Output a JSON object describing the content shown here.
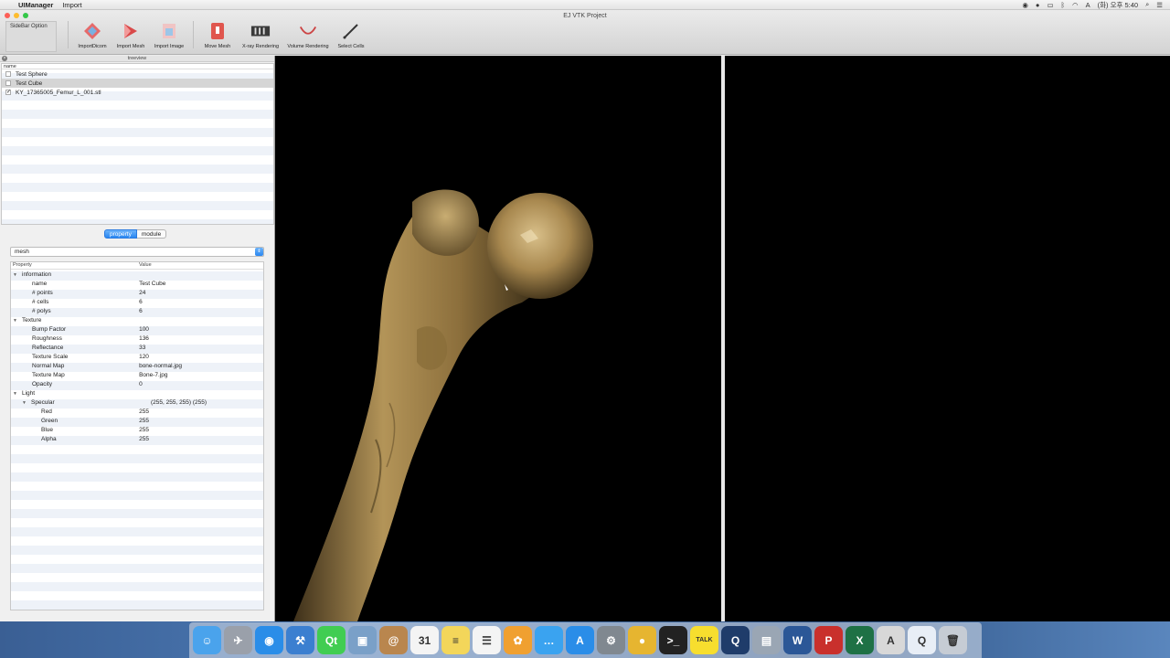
{
  "menubar": {
    "app": "UIManager",
    "menus": [
      "Import"
    ],
    "clock": "(화) 오후 5:40"
  },
  "window": {
    "title": "EJ VTK Project",
    "sidebar_option": "SideBar Option"
  },
  "toolbar": [
    {
      "label": "ImportDicom",
      "icon": "dicom-import-icon",
      "color": "#e05a5a"
    },
    {
      "label": "Import Mesh",
      "icon": "mesh-import-icon",
      "color": "#d84c4c"
    },
    {
      "label": "Import Image",
      "icon": "image-import-icon",
      "color": "#e7a7a7"
    },
    {
      "label": "Move Mesh",
      "icon": "move-mesh-icon",
      "color": "#e2584f"
    },
    {
      "label": "X-ray Rendering",
      "icon": "xray-icon",
      "color": "#3a3a3a"
    },
    {
      "label": "Volume Rendering",
      "icon": "volume-icon",
      "color": "#c44"
    },
    {
      "label": "Select Cells",
      "icon": "select-cells-icon",
      "color": "#333"
    }
  ],
  "treeview": {
    "header": "treeview",
    "column": "name",
    "items": [
      {
        "label": "Test Sphere",
        "checked": false,
        "selected": false
      },
      {
        "label": "Test Cube",
        "checked": false,
        "selected": true
      },
      {
        "label": "KY_17365005_Femur_L_001.stl",
        "checked": true,
        "selected": false
      }
    ]
  },
  "tabs": {
    "property": "property",
    "module": "module"
  },
  "combo": {
    "value": "mesh"
  },
  "properties": {
    "col_property": "Property",
    "col_value": "Value",
    "information": "information",
    "name_k": "name",
    "name_v": "Test Cube",
    "points_k": "# points",
    "points_v": "24",
    "cells_k": "# cells",
    "cells_v": "6",
    "polys_k": "# polys",
    "polys_v": "6",
    "texture": "Texture",
    "bump_k": "Bump Factor",
    "bump_v": "100",
    "rough_k": "Roughness",
    "rough_v": "136",
    "refl_k": "Reflectance",
    "refl_v": "33",
    "tscale_k": "Texture Scale",
    "tscale_v": "120",
    "nmap_k": "Normal Map",
    "nmap_v": "bone-normal.jpg",
    "tmap_k": "Texture Map",
    "tmap_v": "Bone-7.jpg",
    "opacity_k": "Opacity",
    "opacity_v": "0",
    "light": "Light",
    "spec_k": "Specular",
    "spec_v": "(255, 255, 255) (255)",
    "red_k": "Red",
    "red_v": "255",
    "green_k": "Green",
    "green_v": "255",
    "blue_k": "Blue",
    "blue_v": "255",
    "alpha_k": "Alpha",
    "alpha_v": "255"
  },
  "dock": [
    {
      "icon": "finder-icon",
      "color": "#4aa3ec",
      "glyph": "☺"
    },
    {
      "icon": "launchpad-icon",
      "color": "#9aa0aa",
      "glyph": "✈"
    },
    {
      "icon": "safari-icon",
      "color": "#2a8de8",
      "glyph": "◉"
    },
    {
      "icon": "xcode-icon",
      "color": "#3b7fd0",
      "glyph": "⚒"
    },
    {
      "icon": "qt-icon",
      "color": "#41cd52",
      "glyph": "Qt"
    },
    {
      "icon": "preview-icon",
      "color": "#7aa0c8",
      "glyph": "▣"
    },
    {
      "icon": "contacts-icon",
      "color": "#b9864e",
      "glyph": "@"
    },
    {
      "icon": "calendar-icon",
      "color": "#f4f4f4",
      "glyph": "31"
    },
    {
      "icon": "notes-icon",
      "color": "#f3d65a",
      "glyph": "≡"
    },
    {
      "icon": "reminders-icon",
      "color": "#f4f4f4",
      "glyph": "☰"
    },
    {
      "icon": "photos-icon",
      "color": "#f0a030",
      "glyph": "✿"
    },
    {
      "icon": "messages-icon",
      "color": "#3aa3f0",
      "glyph": "…"
    },
    {
      "icon": "appstore-icon",
      "color": "#2a8de8",
      "glyph": "A"
    },
    {
      "icon": "system-preferences-icon",
      "color": "#808890",
      "glyph": "⚙"
    },
    {
      "icon": "chrome-icon",
      "color": "#e6b530",
      "glyph": "●"
    },
    {
      "icon": "terminal-icon",
      "color": "#222",
      "glyph": ">_"
    },
    {
      "icon": "kakaotalk-icon",
      "color": "#f7de2e",
      "glyph": "TALK"
    },
    {
      "icon": "quicktime-icon",
      "color": "#1f3c6a",
      "glyph": "Q"
    },
    {
      "icon": "image-capture-icon",
      "color": "#9aa6b4",
      "glyph": "▤"
    },
    {
      "icon": "word-icon",
      "color": "#2b5797",
      "glyph": "W"
    },
    {
      "icon": "powerpoint-icon",
      "color": "#c9302c",
      "glyph": "P"
    },
    {
      "icon": "excel-icon",
      "color": "#1e7145",
      "glyph": "X"
    },
    {
      "icon": "instruments-icon",
      "color": "#d8d8d8",
      "glyph": "A"
    },
    {
      "icon": "quicktime-doc-icon",
      "color": "#e8eef6",
      "glyph": "Q"
    },
    {
      "icon": "trash-icon",
      "color": "#c6ccd4",
      "glyph": "🗑"
    }
  ]
}
